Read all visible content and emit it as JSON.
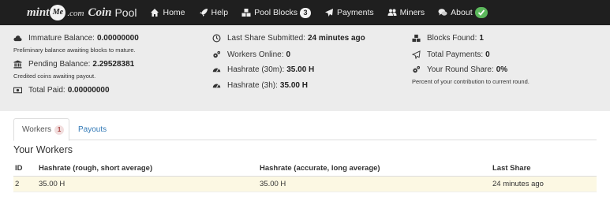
{
  "brand": {
    "mint": "mint",
    "me": "Me",
    "com": ".com",
    "coin": "Coin",
    "pool": "Pool"
  },
  "nav": {
    "items": [
      {
        "label": "Home",
        "icon": "home-icon"
      },
      {
        "label": "Help",
        "icon": "rocket-icon"
      },
      {
        "label": "Pool Blocks",
        "icon": "cubes-icon",
        "badge": "3"
      },
      {
        "label": "Payments",
        "icon": "paper-plane-icon"
      },
      {
        "label": "Miners",
        "icon": "users-icon"
      },
      {
        "label": "About",
        "icon": "comments-icon",
        "badge_icon": "check-icon"
      }
    ],
    "check_color": "#5cb85c"
  },
  "stats": {
    "immature": {
      "label": "Immature Balance:",
      "value": "0.00000000",
      "sub": "Preliminary balance awaiting blocks to mature.",
      "icon": "cloud-icon"
    },
    "pending": {
      "label": "Pending Balance:",
      "value": "2.29528381",
      "sub": "Credited coins awaiting payout.",
      "icon": "bank-icon"
    },
    "total_paid": {
      "label": "Total Paid:",
      "value": "0.00000000",
      "icon": "money-icon"
    },
    "last_share": {
      "label": "Last Share Submitted:",
      "value": "24 minutes ago",
      "icon": "clock-icon"
    },
    "workers_online": {
      "label": "Workers Online:",
      "value": "0",
      "icon": "cogs-icon"
    },
    "hashrate_30m": {
      "label": "Hashrate (30m):",
      "value": "35.00 H",
      "icon": "tachometer-icon"
    },
    "hashrate_3h": {
      "label": "Hashrate (3h):",
      "value": "35.00 H",
      "icon": "tachometer-icon"
    },
    "blocks_found": {
      "label": "Blocks Found:",
      "value": "1",
      "icon": "cubes-icon"
    },
    "total_payments": {
      "label": "Total Payments:",
      "value": "0",
      "icon": "paper-plane-icon"
    },
    "round_share": {
      "label": "Your Round Share:",
      "value": "0%",
      "sub": "Percent of your contribution to current round.",
      "icon": "cogs-icon"
    }
  },
  "tabs": [
    {
      "label": "Workers",
      "badge": "1",
      "active": true
    },
    {
      "label": "Payouts",
      "active": false
    }
  ],
  "section_title": "Your Workers",
  "workers_table": {
    "headers": [
      "ID",
      "Hashrate (rough, short average)",
      "Hashrate (accurate, long average)",
      "Last Share"
    ],
    "rows": [
      [
        "2",
        "35.00 H",
        "35.00 H",
        "24 minutes ago"
      ]
    ]
  }
}
